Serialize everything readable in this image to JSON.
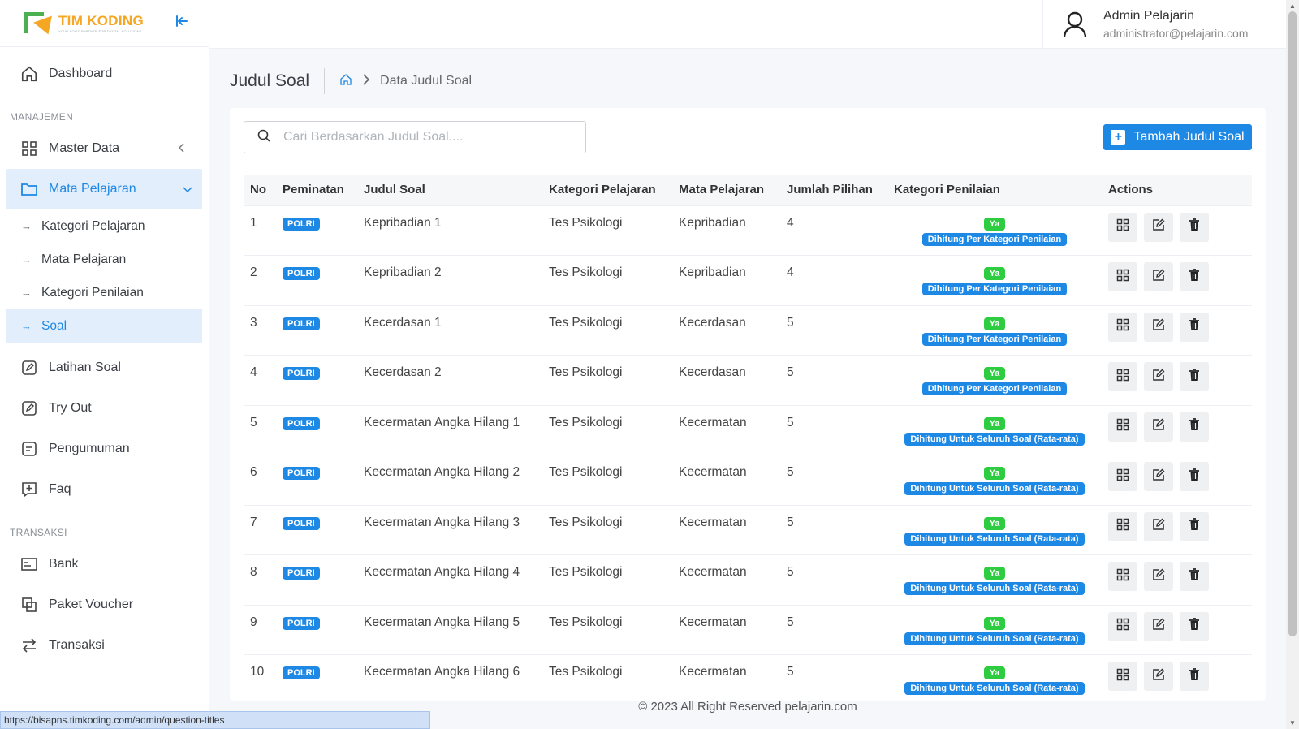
{
  "brand": {
    "title": "TIM KODING",
    "tagline": "YOUR SOLID PARTNER FOR DIGITAL SOLUTIONS"
  },
  "nav": {
    "dashboard": "Dashboard",
    "manajemen_label": "MANAJEMEN",
    "master_data": "Master Data",
    "mata_pelajaran": "Mata Pelajaran",
    "sub": [
      "Kategori Pelajaran",
      "Mata Pelajaran",
      "Kategori Penilaian",
      "Soal"
    ],
    "latihan_soal": "Latihan Soal",
    "try_out": "Try Out",
    "pengumuman": "Pengumuman",
    "faq": "Faq",
    "transaksi_label": "TRANSAKSI",
    "bank": "Bank",
    "paket_voucher": "Paket Voucher",
    "transaksi": "Transaksi"
  },
  "user": {
    "name": "Admin Pelajarin",
    "email": "administrator@pelajarin.com"
  },
  "page": {
    "title": "Judul Soal",
    "breadcrumb": "Data Judul Soal"
  },
  "search": {
    "placeholder": "Cari Berdasarkan Judul Soal...."
  },
  "add_button": "Tambah Judul Soal",
  "table": {
    "headers": [
      "No",
      "Peminatan",
      "Judul Soal",
      "Kategori Pelajaran",
      "Mata Pelajaran",
      "Jumlah Pilihan",
      "Kategori Penilaian",
      "Actions"
    ],
    "rows": [
      {
        "no": "1",
        "peminatan": "POLRI",
        "judul": "Kepribadian 1",
        "kategori": "Tes Psikologi",
        "mapel": "Kepribadian",
        "jumlah": "4",
        "ya": "Ya",
        "penilaian": "Dihitung Per Kategori Penilaian"
      },
      {
        "no": "2",
        "peminatan": "POLRI",
        "judul": "Kepribadian 2",
        "kategori": "Tes Psikologi",
        "mapel": "Kepribadian",
        "jumlah": "4",
        "ya": "Ya",
        "penilaian": "Dihitung Per Kategori Penilaian"
      },
      {
        "no": "3",
        "peminatan": "POLRI",
        "judul": "Kecerdasan 1",
        "kategori": "Tes Psikologi",
        "mapel": "Kecerdasan",
        "jumlah": "5",
        "ya": "Ya",
        "penilaian": "Dihitung Per Kategori Penilaian"
      },
      {
        "no": "4",
        "peminatan": "POLRI",
        "judul": "Kecerdasan 2",
        "kategori": "Tes Psikologi",
        "mapel": "Kecerdasan",
        "jumlah": "5",
        "ya": "Ya",
        "penilaian": "Dihitung Per Kategori Penilaian"
      },
      {
        "no": "5",
        "peminatan": "POLRI",
        "judul": "Kecermatan Angka Hilang 1",
        "kategori": "Tes Psikologi",
        "mapel": "Kecermatan",
        "jumlah": "5",
        "ya": "Ya",
        "penilaian": "Dihitung Untuk Seluruh Soal (Rata-rata)"
      },
      {
        "no": "6",
        "peminatan": "POLRI",
        "judul": "Kecermatan Angka Hilang 2",
        "kategori": "Tes Psikologi",
        "mapel": "Kecermatan",
        "jumlah": "5",
        "ya": "Ya",
        "penilaian": "Dihitung Untuk Seluruh Soal (Rata-rata)"
      },
      {
        "no": "7",
        "peminatan": "POLRI",
        "judul": "Kecermatan Angka Hilang 3",
        "kategori": "Tes Psikologi",
        "mapel": "Kecermatan",
        "jumlah": "5",
        "ya": "Ya",
        "penilaian": "Dihitung Untuk Seluruh Soal (Rata-rata)"
      },
      {
        "no": "8",
        "peminatan": "POLRI",
        "judul": "Kecermatan Angka Hilang 4",
        "kategori": "Tes Psikologi",
        "mapel": "Kecermatan",
        "jumlah": "5",
        "ya": "Ya",
        "penilaian": "Dihitung Untuk Seluruh Soal (Rata-rata)"
      },
      {
        "no": "9",
        "peminatan": "POLRI",
        "judul": "Kecermatan Angka Hilang 5",
        "kategori": "Tes Psikologi",
        "mapel": "Kecermatan",
        "jumlah": "5",
        "ya": "Ya",
        "penilaian": "Dihitung Untuk Seluruh Soal (Rata-rata)"
      },
      {
        "no": "10",
        "peminatan": "POLRI",
        "judul": "Kecermatan Angka Hilang 6",
        "kategori": "Tes Psikologi",
        "mapel": "Kecermatan",
        "jumlah": "5",
        "ya": "Ya",
        "penilaian": "Dihitung Untuk Seluruh Soal (Rata-rata)"
      }
    ]
  },
  "footer": "© 2023 All Right Reserved pelajarin.com",
  "status_url": "https://bisapns.timkoding.com/admin/question-titles",
  "colors": {
    "accent": "#1e88e5",
    "success": "#2ecc40",
    "brand_orange": "#f5a623",
    "brand_green": "#4caf50"
  }
}
